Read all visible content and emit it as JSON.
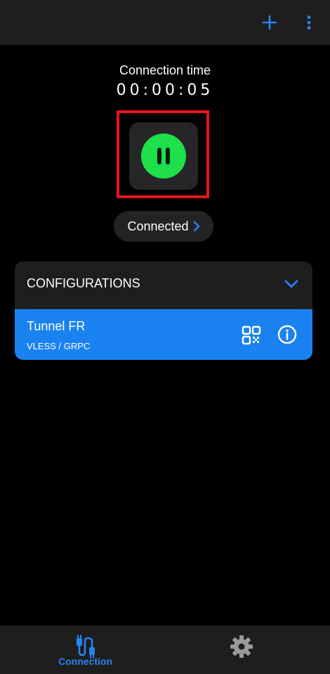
{
  "header": {
    "add_icon": "plus-icon",
    "menu_icon": "more-vertical-icon"
  },
  "connection": {
    "time_label": "Connection time",
    "timer": "00:00:05",
    "toggle_icon": "pause-icon",
    "status": "Connected",
    "status_icon": "chevron-right-icon"
  },
  "configurations": {
    "title": "CONFIGURATIONS",
    "expand_icon": "chevron-down-icon",
    "items": [
      {
        "name": "Tunnel FR",
        "type": "VLESS / GRPC",
        "qr_icon": "qr-code-icon",
        "info_icon": "info-icon"
      }
    ]
  },
  "bottom_nav": {
    "items": [
      {
        "label": "Connection",
        "icon": "connection-plug-icon",
        "active": true
      },
      {
        "label": "",
        "icon": "gear-icon",
        "active": false
      }
    ]
  },
  "colors": {
    "accent": "#1a82f0",
    "active_green": "#1ee04a",
    "highlight_red": "#e8141b",
    "surface": "#1e1e1e",
    "background": "#000000"
  }
}
